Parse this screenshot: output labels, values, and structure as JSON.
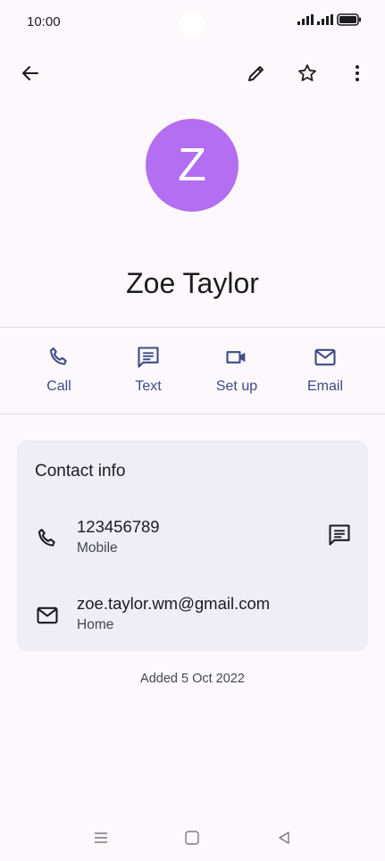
{
  "status": {
    "time": "10:00"
  },
  "top_bar": {
    "back_icon": "arrow-left-icon",
    "edit_icon": "pencil-icon",
    "favorite_icon": "star-outline-icon",
    "more_icon": "more-vert-icon"
  },
  "contact": {
    "initial": "Z",
    "avatar_color": "#b36ef2",
    "name": "Zoe Taylor"
  },
  "actions": [
    {
      "label": "Call",
      "icon": "phone-icon"
    },
    {
      "label": "Text",
      "icon": "message-icon"
    },
    {
      "label": "Set up",
      "icon": "video-icon"
    },
    {
      "label": "Email",
      "icon": "mail-icon"
    }
  ],
  "contact_info": {
    "title": "Contact info",
    "phone": {
      "value": "123456789",
      "type": "Mobile"
    },
    "email": {
      "value": "zoe.taylor.wm@gmail.com",
      "type": "Home"
    }
  },
  "footer": {
    "added": "Added 5 Oct 2022"
  },
  "colors": {
    "accent": "#3e4b85",
    "background": "#fdf8fc",
    "card": "#efedf6"
  }
}
